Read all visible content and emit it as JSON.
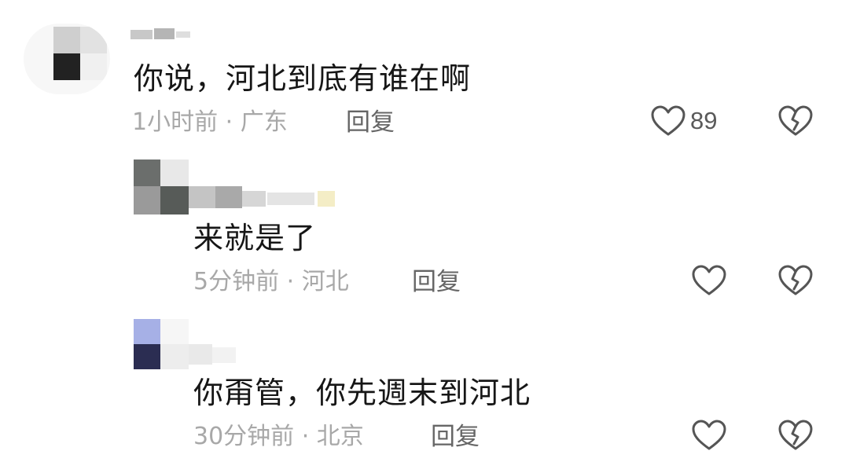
{
  "comments": [
    {
      "text": "你说，河北到底有谁在啊",
      "time": "1小时前",
      "location": "广东",
      "reply_label": "回复",
      "likes": "89"
    },
    {
      "text": "来就是了",
      "time": "5分钟前",
      "location": "河北",
      "reply_label": "回复",
      "likes": ""
    },
    {
      "text": "你甭管，你先週末到河北",
      "time": "30分钟前",
      "location": "北京",
      "reply_label": "回复",
      "likes": ""
    }
  ],
  "separator": " · ",
  "icons": {
    "like": "heart-outline-icon",
    "dislike": "broken-heart-icon"
  },
  "colors": {
    "text": "#161616",
    "meta": "#a8a8a8",
    "reply": "#666666",
    "icon": "#555555"
  }
}
